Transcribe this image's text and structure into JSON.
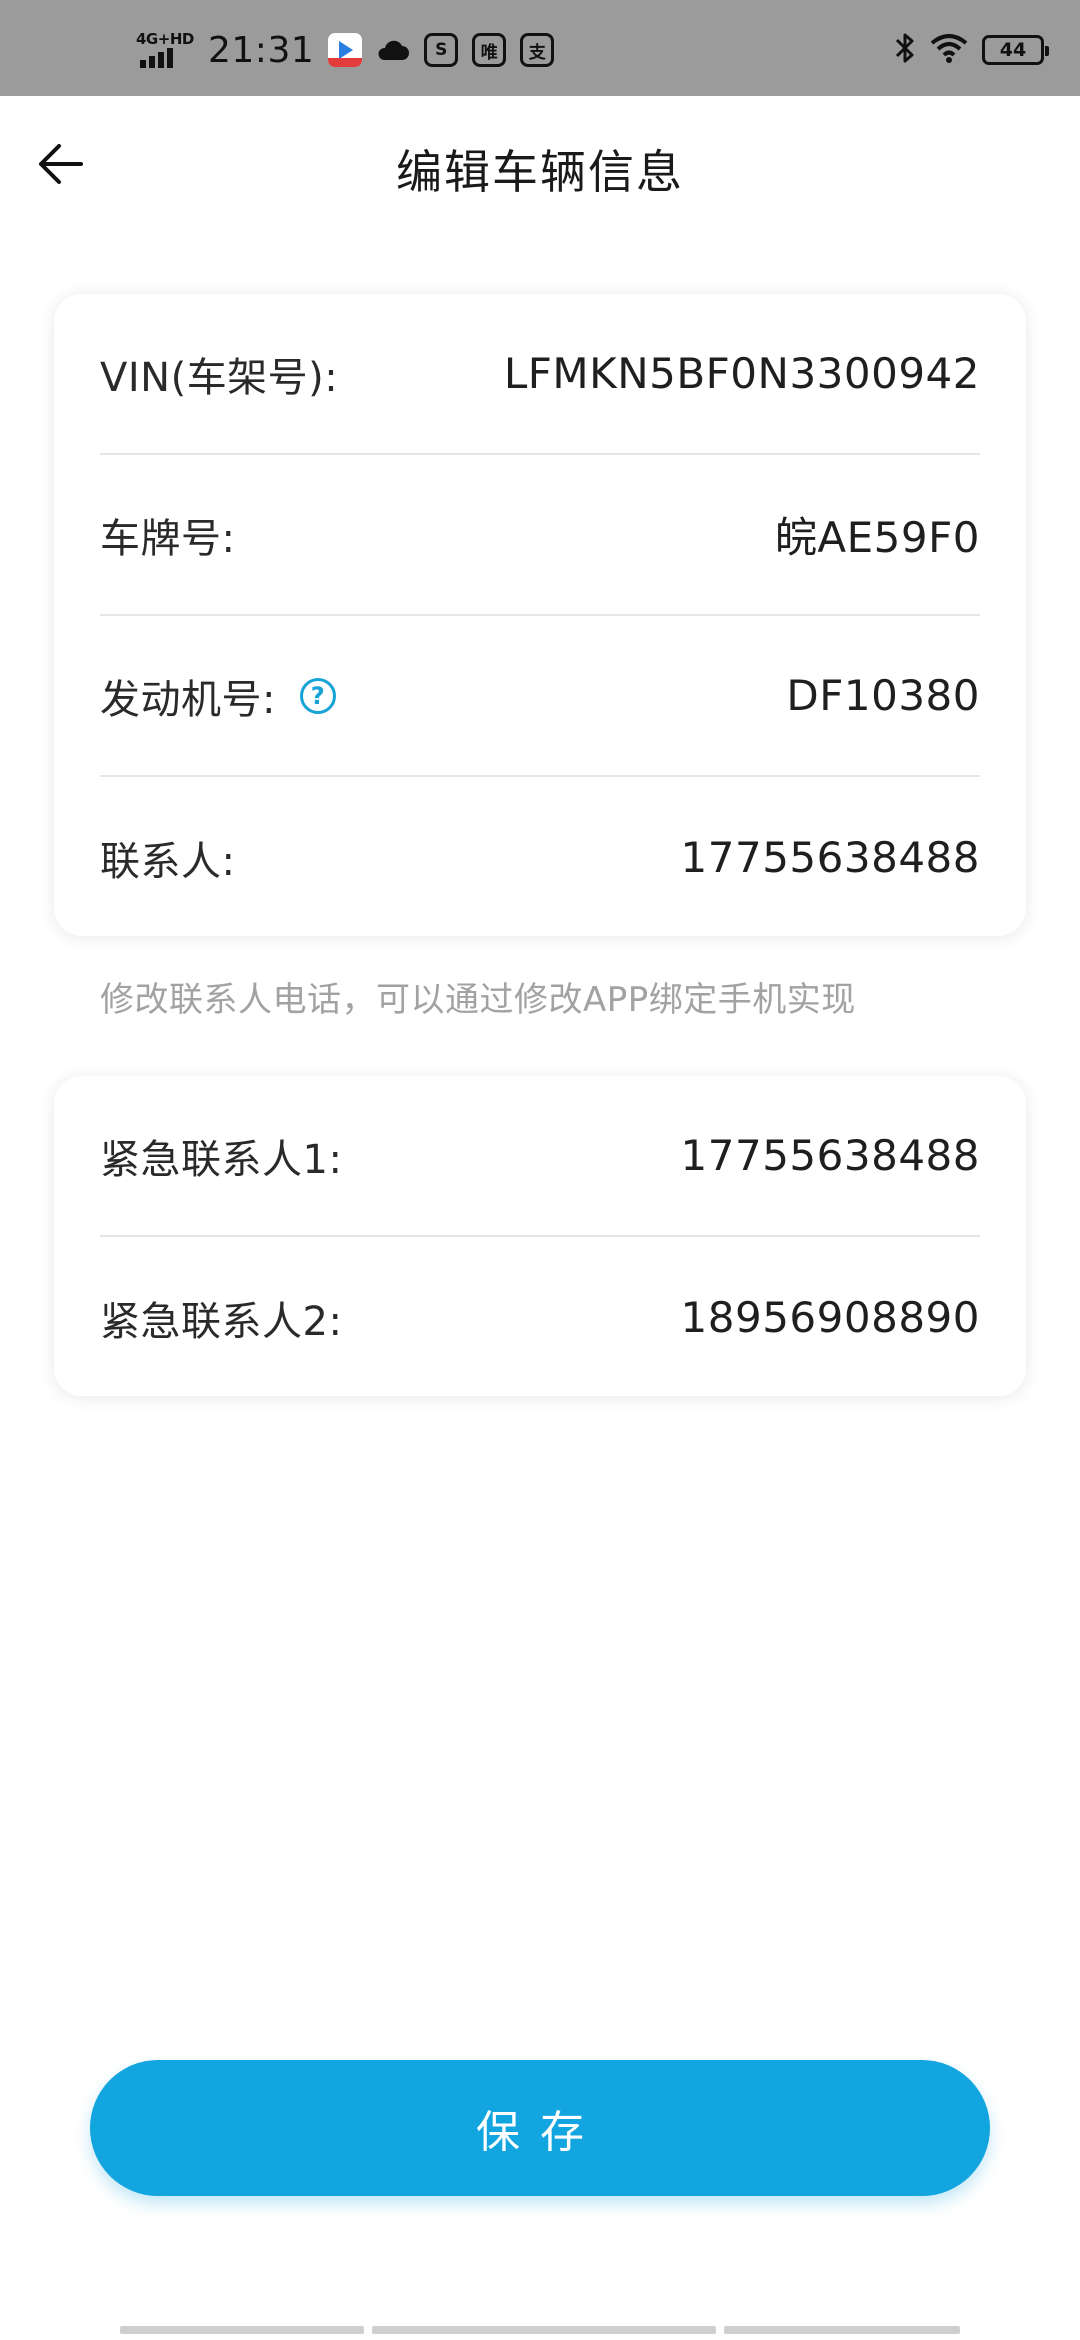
{
  "status_bar": {
    "network": "4G+HD",
    "time": "21:31",
    "battery": "44",
    "icons": [
      "video-app-icon",
      "cloud-icon",
      "s-app-icon",
      "wei-app-icon",
      "zhi-app-icon",
      "bluetooth-icon",
      "wifi-icon",
      "battery-icon"
    ]
  },
  "header": {
    "title": "编辑车辆信息",
    "back_icon": "back-arrow-icon"
  },
  "vehicle_card": {
    "vin_label": "VIN(车架号):",
    "vin_value": "LFMKN5BF0N3300942",
    "plate_label": "车牌号:",
    "plate_value": "皖AE59F0",
    "engine_label": "发动机号:",
    "engine_help": "?",
    "engine_value": "DF10380",
    "contact_label": "联系人:",
    "contact_value": "17755638488"
  },
  "hint": "修改联系人电话，可以通过修改APP绑定手机实现",
  "emergency_card": {
    "contact1_label": "紧急联系人1:",
    "contact1_value": "17755638488",
    "contact2_label": "紧急联系人2:",
    "contact2_value": "18956908890"
  },
  "save_label": "保存",
  "colors": {
    "accent": "#12a5e0",
    "help_icon": "#17a3d6",
    "hint_text": "#a2a2a2",
    "status_bar_bg": "#9b9b9b"
  }
}
